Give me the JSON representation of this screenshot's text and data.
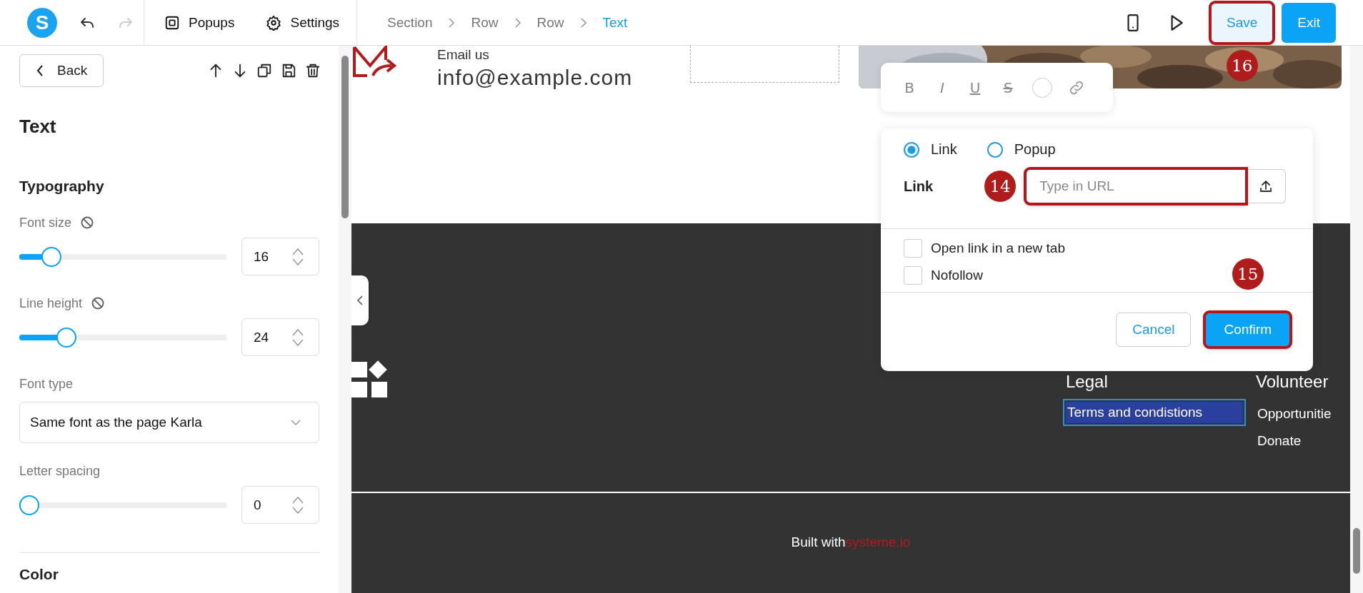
{
  "topbar": {
    "logo": "S",
    "history": [
      {
        "kind": "undo",
        "disabled": false
      },
      {
        "kind": "redo",
        "disabled": true
      }
    ],
    "menu": [
      {
        "kind": "popups",
        "label": "Popups"
      },
      {
        "kind": "settings",
        "label": "Settings"
      }
    ],
    "breadcrumb": [
      {
        "label": "Section",
        "selected": false
      },
      {
        "label": "Row",
        "selected": false
      },
      {
        "label": "Row",
        "selected": false
      },
      {
        "label": "Text",
        "selected": true
      }
    ],
    "preview": [
      {
        "kind": "mobile"
      },
      {
        "kind": "play"
      }
    ],
    "buttons": [
      {
        "label": "Save",
        "kind": "secondary",
        "highlighted": true,
        "step": "16"
      },
      {
        "label": "Exit",
        "kind": "primary",
        "highlighted": false
      }
    ]
  },
  "sidebar": {
    "back": "Back",
    "actions": [
      {
        "kind": "up"
      },
      {
        "kind": "down"
      },
      {
        "kind": "copy"
      },
      {
        "kind": "save"
      },
      {
        "kind": "delete"
      }
    ],
    "title": "Text",
    "section": "Typography",
    "controls": [
      {
        "kind": "slider",
        "label": "Font size",
        "resettable": true,
        "level": 0.12,
        "value": "16"
      },
      {
        "kind": "slider",
        "label": "Line height",
        "resettable": true,
        "level": 0.2,
        "value": "24"
      },
      {
        "kind": "select",
        "label": "Font type",
        "value": "Same font as the page Karla"
      },
      {
        "kind": "slider",
        "label": "Letter spacing",
        "resettable": false,
        "level": 0,
        "value": "0"
      }
    ],
    "next_section": "Color"
  },
  "canvas": {
    "contact": {
      "label": "Email us",
      "address": "info@example.com"
    },
    "footer": {
      "columns": [
        {
          "heading": "Legal",
          "links": [
            {
              "label": "Terms and condistions",
              "selected": true
            }
          ]
        },
        {
          "heading": "Volunteer",
          "links": [
            {
              "label": "Opportunitie",
              "selected": false
            },
            {
              "label": "Donate",
              "selected": false
            }
          ]
        }
      ],
      "credit": {
        "text": "Built with",
        "brand": "systeme.io"
      }
    }
  },
  "format_toolbar": [
    {
      "kind": "bold",
      "label": "B"
    },
    {
      "kind": "italic",
      "label": "I"
    },
    {
      "kind": "underline",
      "label": "U"
    },
    {
      "kind": "strike",
      "label": "S"
    },
    {
      "kind": "color"
    },
    {
      "kind": "link"
    }
  ],
  "link_dialog": {
    "modes": [
      {
        "label": "Link",
        "selected": true
      },
      {
        "label": "Popup",
        "selected": false
      }
    ],
    "field_label": "Link",
    "url": {
      "placeholder": "Type in URL",
      "highlighted": true,
      "step": "14"
    },
    "options": [
      {
        "label": "Open link in a new tab",
        "checked": false
      },
      {
        "label": "Nofollow",
        "checked": false
      }
    ],
    "buttons": [
      {
        "label": "Cancel",
        "kind": "secondary",
        "highlighted": false
      },
      {
        "label": "Confirm",
        "kind": "primary",
        "highlighted": true,
        "step": "15"
      }
    ]
  }
}
